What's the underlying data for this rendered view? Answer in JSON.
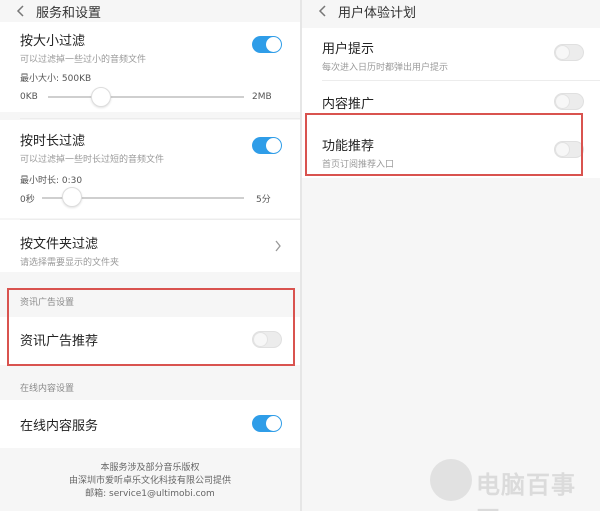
{
  "left": {
    "title": "服务和设置",
    "size_filter": {
      "title": "按大小过滤",
      "subtitle": "可以过滤掉一些过小的音频文件",
      "min_label": "最小大小: 500KB",
      "range_start": "0KB",
      "range_end": "2MB",
      "value_fraction": 0.25,
      "enabled": true
    },
    "duration_filter": {
      "title": "按时长过滤",
      "subtitle": "可以过滤掉一些时长过短的音频文件",
      "min_label": "最小时长: 0:30",
      "range_start": "0秒",
      "range_end": "5分",
      "value_fraction": 0.1,
      "enabled": true
    },
    "folder_filter": {
      "title": "按文件夹过滤",
      "subtitle": "请选择需要显示的文件夹"
    },
    "ad_section": {
      "label": "资讯广告设置",
      "item_title": "资讯广告推荐",
      "enabled": false
    },
    "online_section": {
      "label": "在线内容设置",
      "item_title": "在线内容服务",
      "enabled": true
    },
    "footer": {
      "line1": "本服务涉及部分音乐版权",
      "line2": "由深圳市爱听卓乐文化科技有限公司提供",
      "line3": "邮箱: service1@ultimobi.com"
    }
  },
  "right": {
    "title": "用户体验计划",
    "items": [
      {
        "title": "用户提示",
        "subtitle": "每次进入日历时都弹出用户提示",
        "enabled": false
      },
      {
        "title": "内容推广",
        "subtitle": "",
        "enabled": false
      },
      {
        "title": "功能推荐",
        "subtitle": "首页订阅推荐入口",
        "enabled": false
      }
    ]
  },
  "watermark": {
    "text": "电脑百事网"
  },
  "colors": {
    "accent": "#2f9de8",
    "highlight_box": "#d9534f"
  },
  "icons": {
    "back": "chevron-left-icon",
    "forward": "chevron-right-icon"
  }
}
